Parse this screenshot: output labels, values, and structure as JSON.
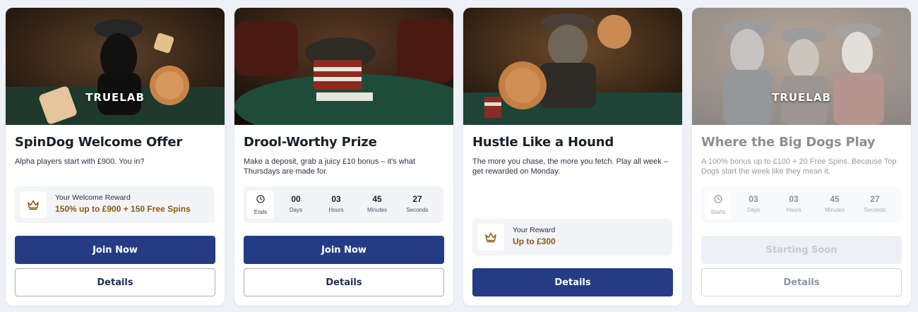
{
  "cards": [
    {
      "brand": "TRUELAB",
      "title": "SpinDog Welcome Offer",
      "description": "Alpha players start with £900. You in?",
      "reward": {
        "icon": "crown-icon",
        "label": "Your Welcome Reward",
        "value": "150% up to £900 + 150 Free Spins"
      },
      "primary_label": "Join Now",
      "details_label": "Details"
    },
    {
      "title": "Drool-Worthy Prize",
      "description": "Make a deposit, grab a juicy £10 bonus – it's what Thursdays are made for.",
      "timer": {
        "icon": "clock-icon",
        "status": "Ends",
        "days": "00",
        "days_label": "Days",
        "hours": "03",
        "hours_label": "Hours",
        "minutes": "45",
        "minutes_label": "Minutes",
        "seconds": "27",
        "seconds_label": "Seconds"
      },
      "primary_label": "Join Now",
      "details_label": "Details"
    },
    {
      "title": "Hustle Like a Hound",
      "description": "The more you chase, the more you fetch. Play all week – get rewarded on Monday.",
      "reward": {
        "icon": "crown-icon",
        "label": "Your Reward",
        "value": "Up to £300"
      },
      "primary_label": "Details"
    },
    {
      "brand": "TRUELAB",
      "title": "Where the Big Dogs Play",
      "description": "A 100% bonus up to £100 + 20 Free Spins. Because Top Dogs start the week like they mean it.",
      "timer": {
        "icon": "clock-icon",
        "status": "Starts",
        "days": "03",
        "days_label": "Days",
        "hours": "03",
        "hours_label": "Hours",
        "minutes": "45",
        "minutes_label": "Minutes",
        "seconds": "27",
        "seconds_label": "Seconds"
      },
      "primary_label": "Starting Soon",
      "details_label": "Details"
    }
  ],
  "colors": {
    "primary": "#243c85",
    "reward_value": "#8a5a10",
    "page_bg": "#eef1f6"
  }
}
